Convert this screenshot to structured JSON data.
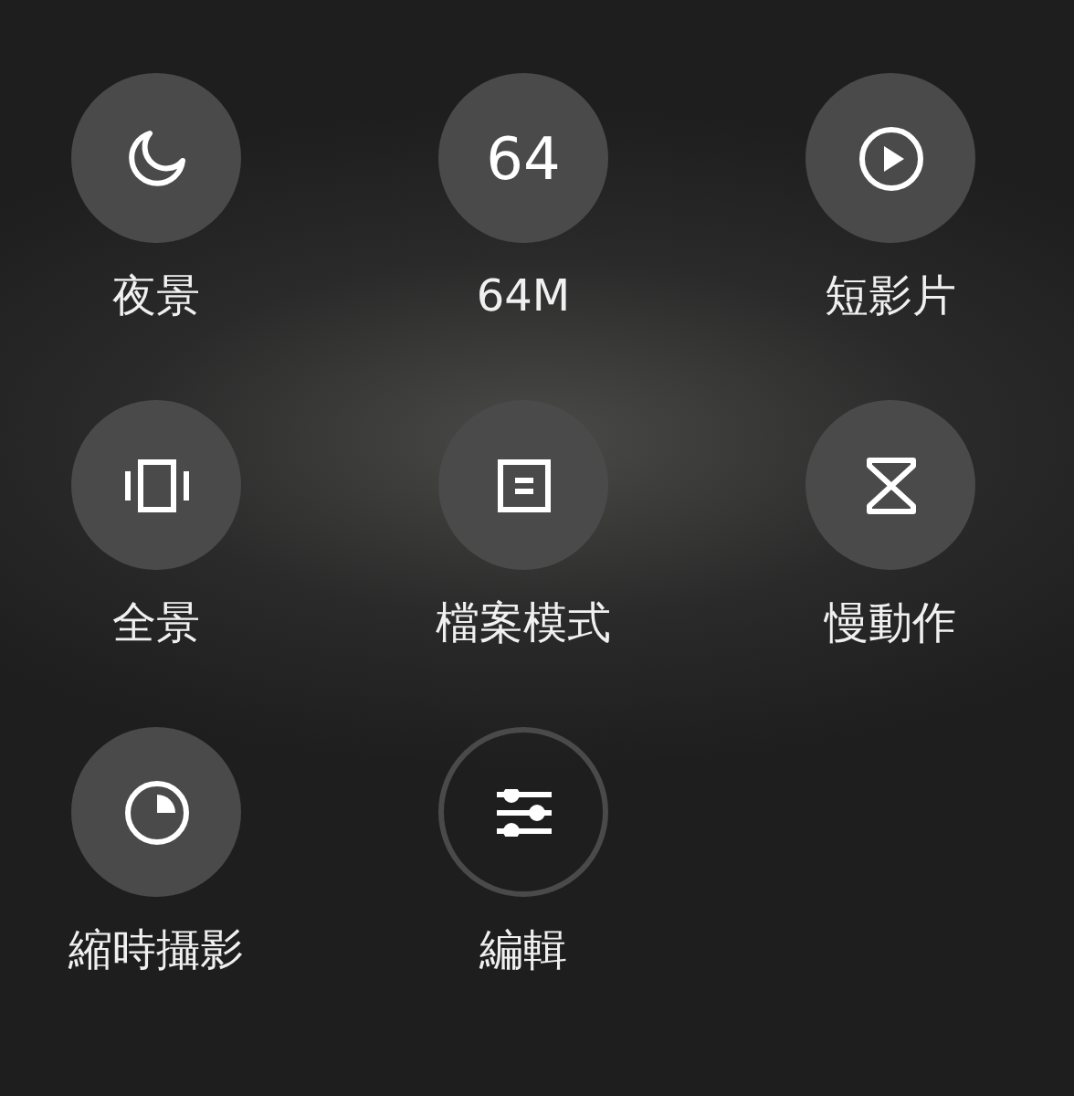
{
  "modes": [
    {
      "kind": "mode",
      "label": "夜景"
    },
    {
      "kind": "mode",
      "label": "64M",
      "badge": "64"
    },
    {
      "kind": "mode",
      "label": "短影片"
    },
    {
      "kind": "mode",
      "label": "全景"
    },
    {
      "kind": "mode",
      "label": "檔案模式"
    },
    {
      "kind": "mode",
      "label": "慢動作"
    },
    {
      "kind": "mode",
      "label": "縮時攝影"
    },
    {
      "kind": "edit",
      "label": "編輯"
    }
  ]
}
